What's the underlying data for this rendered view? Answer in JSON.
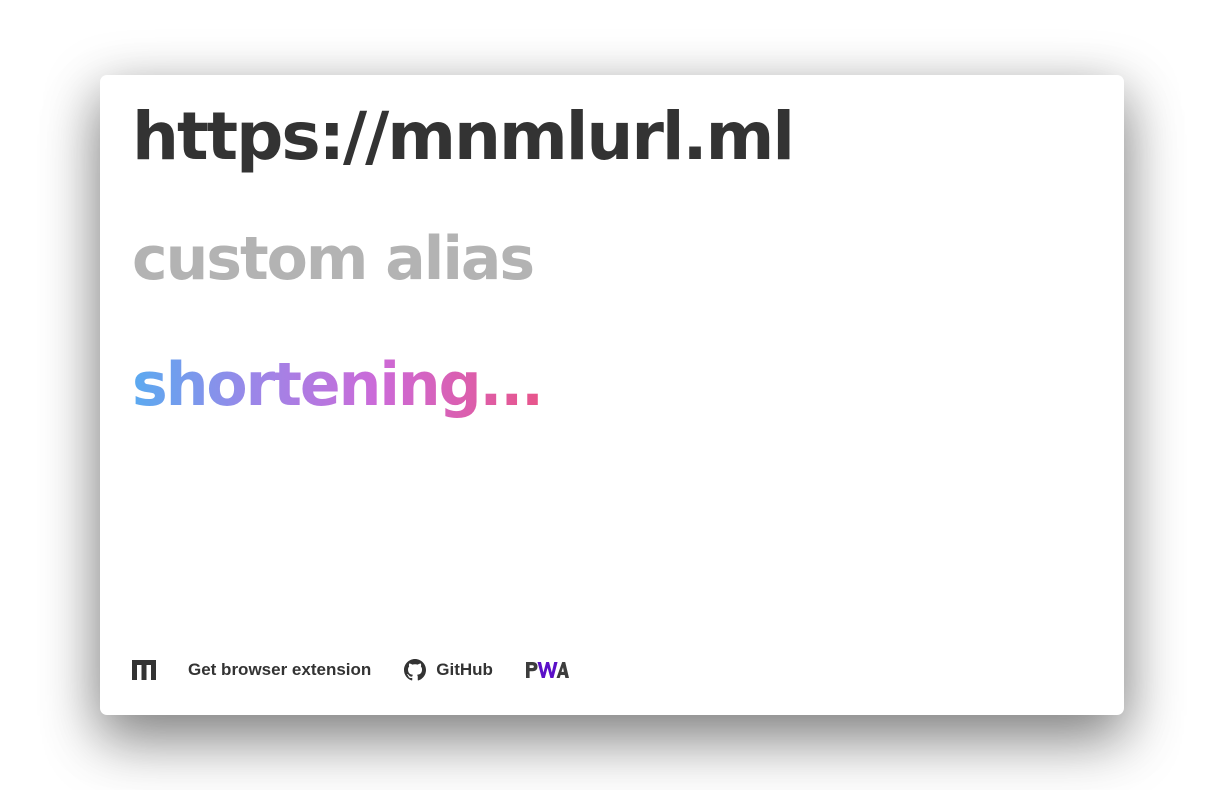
{
  "header": {
    "url": "https://mnmlurl.ml"
  },
  "form": {
    "alias_placeholder": "custom alias",
    "alias_value": ""
  },
  "status": {
    "text": "shortening..."
  },
  "footer": {
    "logo_icon": "mnml-logo-icon",
    "extension_label": "Get browser extension",
    "github_icon": "github-icon",
    "github_label": "GitHub",
    "pwa_icon": "pwa-badge-icon"
  },
  "colors": {
    "text_primary": "#333333",
    "placeholder": "#b3b3b3",
    "gradient_start": "#5aaaf0",
    "gradient_mid": "#cc6ad8",
    "gradient_end": "#e8558a",
    "pwa_accent": "#5a0fc8"
  }
}
